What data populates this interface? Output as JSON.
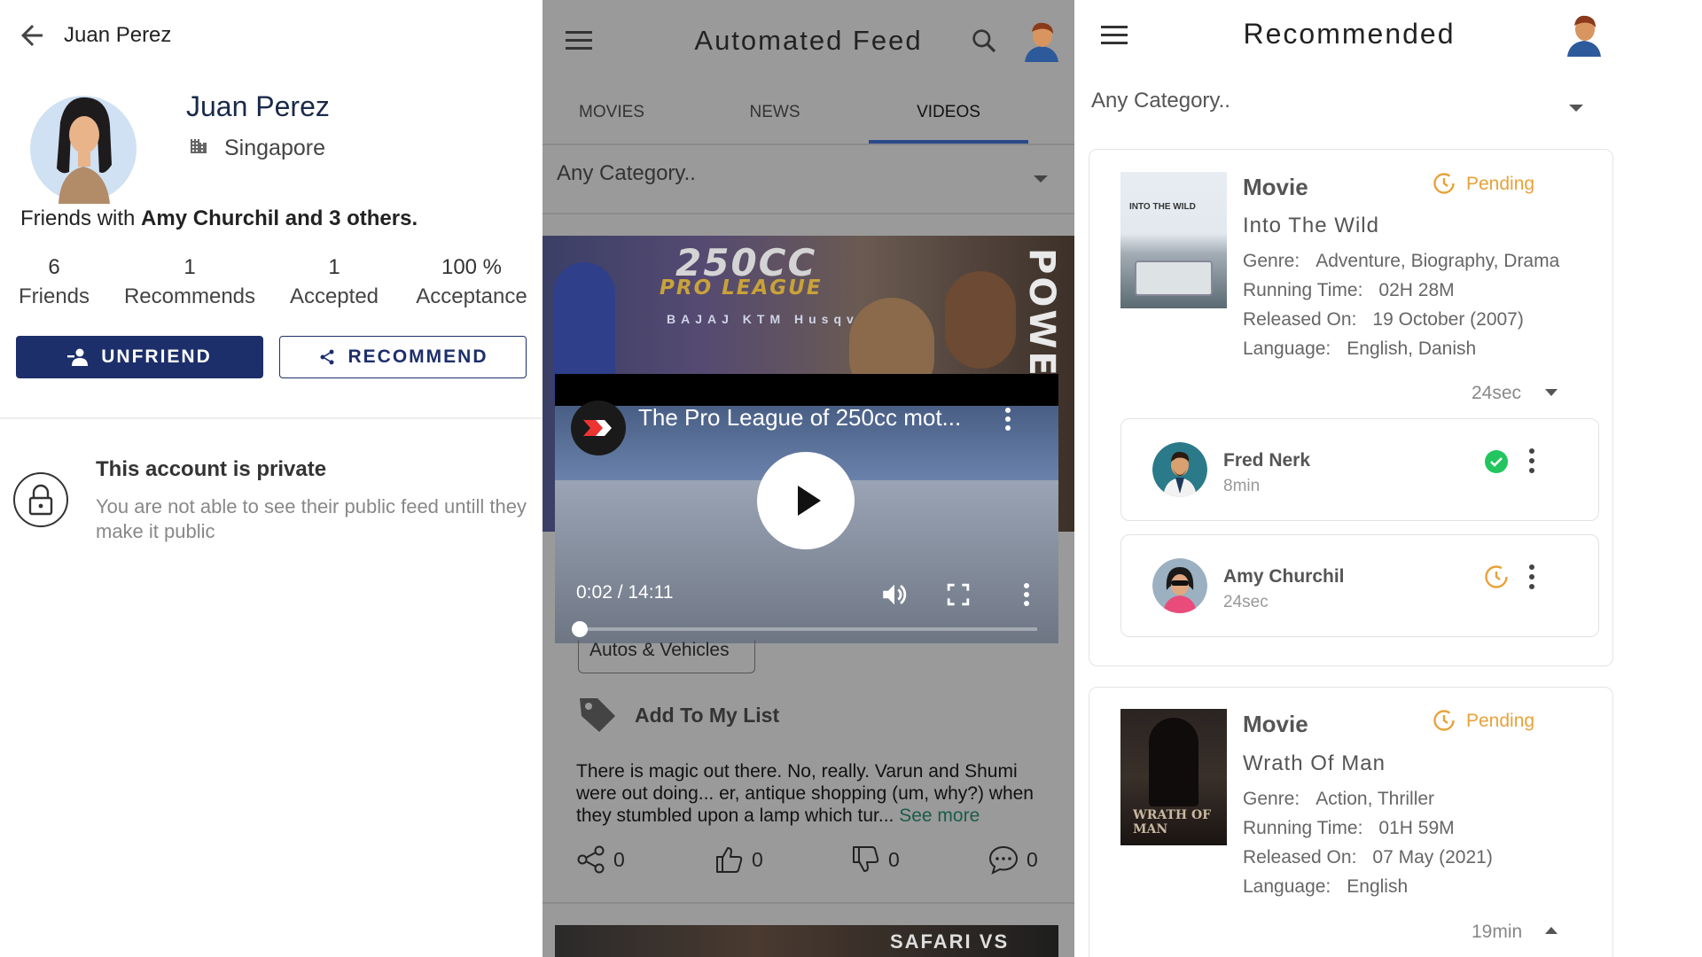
{
  "profile": {
    "top_name": "Juan Perez",
    "name": "Juan Perez",
    "city": "Singapore",
    "friends_with_prefix": "Friends with",
    "friends_with_names": "Amy Churchil and 3 others.",
    "stats": [
      {
        "value": "6",
        "label": "Friends"
      },
      {
        "value": "1",
        "label": "Recommends"
      },
      {
        "value": "1",
        "label": "Accepted"
      },
      {
        "value": "100 %",
        "label": "Acceptance"
      }
    ],
    "unfriend_label": "UNFRIEND",
    "recommend_label": "RECOMMEND",
    "private_title": "This account is private",
    "private_desc": "You are not able to see their public feed untill they make it public"
  },
  "feed": {
    "title": "Automated Feed",
    "tabs": [
      "MOVIES",
      "NEWS",
      "VIDEOS"
    ],
    "active_tab": "VIDEOS",
    "category_placeholder": "Any Category..",
    "thumb_title": "250CC",
    "thumb_subtitle": "PRO LEAGUE",
    "thumb_side": "POWER",
    "thumb_sponsors": "BAJAJ KTM Husqvarna",
    "video_title": "The Pro League of 250cc mot...",
    "video_time": "0:02 / 14:11",
    "video_progress": 0.0024,
    "chip_label": "Autos & Vehicles",
    "add_list_label": "Add To My List",
    "description": "There is magic out there. No, really. Varun and Shumi were out doing... er, antique shopping (um, why?) when they stumbled upon a lamp which tur...",
    "see_more": "See more",
    "share_count": "0",
    "like_count": "0",
    "dislike_count": "0",
    "comment_count": "0",
    "next_thumb_text": "SAFARI VS INNOVA"
  },
  "recommended": {
    "title": "Recommended",
    "category_placeholder": "Any Category..",
    "cards": [
      {
        "type": "Movie",
        "status": "Pending",
        "title": "Into The Wild",
        "poster_text": "INTO THE WILD",
        "genre_label": "Genre:",
        "genre": "Adventure, Biography, Drama",
        "runtime_label": "Running Time:",
        "runtime": "02H 28M",
        "released_label": "Released On:",
        "released": "19 October (2007)",
        "language_label": "Language:",
        "language": "English, Danish",
        "age": "24sec",
        "recipients": [
          {
            "name": "Fred Nerk",
            "time": "8min",
            "status": "accepted"
          },
          {
            "name": "Amy Churchil",
            "time": "24sec",
            "status": "pending"
          }
        ]
      },
      {
        "type": "Movie",
        "status": "Pending",
        "title": "Wrath Of Man",
        "poster_text": "WRATH OF MAN",
        "genre_label": "Genre:",
        "genre": "Action, Thriller",
        "runtime_label": "Running Time:",
        "runtime": "01H 59M",
        "released_label": "Released On:",
        "released": "07 May (2021)",
        "language_label": "Language:",
        "language": "English",
        "age": "19min"
      }
    ]
  },
  "colors": {
    "primary": "#1c2f6b",
    "pending": "#e8a23a",
    "accepted": "#22c55e",
    "overlay_gray": "#9a9a9a"
  }
}
